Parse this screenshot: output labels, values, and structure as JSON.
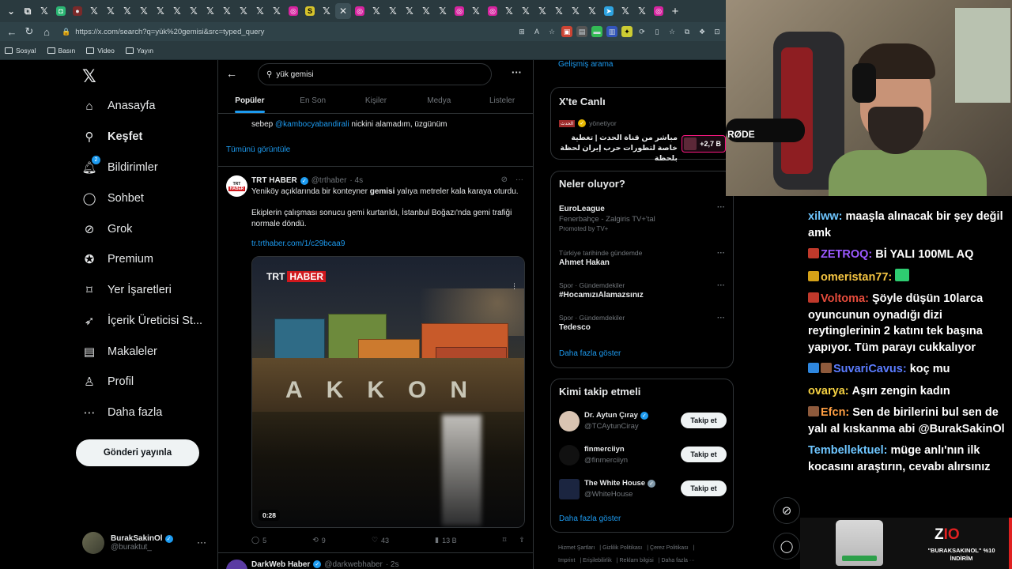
{
  "browser": {
    "tabs": [
      "",
      "",
      "",
      "",
      "",
      "",
      "",
      "",
      "",
      "",
      "",
      "",
      "",
      "",
      "",
      "",
      "",
      "",
      "",
      "",
      "",
      "",
      "",
      "",
      "",
      "",
      "",
      "",
      "",
      "",
      "",
      "",
      "",
      "",
      "",
      "",
      "",
      "",
      "",
      "",
      "",
      ""
    ],
    "url": "https://x.com/search?q=yük%20gemisi&src=typed_query",
    "bookmarks": [
      "Sosyal",
      "Basın",
      "Video",
      "Yayın"
    ]
  },
  "nav": {
    "items": [
      "Anasayfa",
      "Keşfet",
      "Bildirimler",
      "Sohbet",
      "Grok",
      "Premium",
      "Yer İşaretleri",
      "İçerik Üreticisi St...",
      "Makaleler",
      "Profil",
      "Daha fazla"
    ],
    "notif_badge": "2",
    "post_button": "Gönderi yayınla",
    "account_name": "BurakSakinOl",
    "account_handle": "@buraktut_"
  },
  "search": {
    "query": "yük gemisi",
    "tabs": [
      "Popüler",
      "En Son",
      "Kişiler",
      "Medya",
      "Listeler"
    ]
  },
  "prev_post": {
    "text_prefix": "sebep ",
    "mention": "@kambocyabandirali",
    "text_suffix": " nickini alamadım, üzgünüm",
    "show_all": "Tümünü görüntüle"
  },
  "tweet": {
    "avatar_top": "TRT",
    "avatar_bottom": "HABER",
    "name": "TRT HABER",
    "handle": "@trthaber",
    "time": "· 4s",
    "line1_pre": "Yeniköy açıklarında bir konteyner ",
    "line1_bold": "gemisi",
    "line1_post": " yalıya metreler kala karaya oturdu.",
    "line2": "Ekiplerin çalışması sonucu gemi kurtarıldı, İstanbul Boğazı'nda gemi trafiği normale döndü.",
    "link": "tr.trthaber.com/1/c29bcaa9",
    "media_logo_a": "TRT",
    "media_logo_b": "HABER",
    "media_ship_text": "AKKON",
    "duration": "0:28",
    "replies": "5",
    "reposts": "9",
    "likes": "43",
    "views": "13 B"
  },
  "next_tweet": {
    "name": "DarkWeb Haber",
    "handle": "@darkwebhaber",
    "time": "· 2s"
  },
  "right": {
    "advanced_search": "Gelişmiş arama",
    "live_title": "X'te Canlı",
    "live_source": "yönetiyor",
    "live_text": "مباشر من قناة الحدث | تغطية خاصة لتطورات حرب إيران لحظة بلحظة",
    "live_count": "+2,7 B",
    "trends_title": "Neler oluyor?",
    "trends": [
      {
        "ctx": "",
        "title": "EuroLeague",
        "sub": "Fenerbahçe - Zalgiris TV+'tal",
        "promo": "Promoted by TV+"
      },
      {
        "ctx": "Türkiye tarihinde gündemde",
        "title": "Ahmet Hakan",
        "sub": "",
        "promo": ""
      },
      {
        "ctx": "Spor · Gündemdekiler",
        "title": "#HocamızıAlamazsınız",
        "sub": "",
        "promo": ""
      },
      {
        "ctx": "Spor · Gündemdekiler",
        "title": "Tedesco",
        "sub": "",
        "promo": ""
      }
    ],
    "show_more": "Daha fazla göster",
    "who_title": "Kimi takip etmeli",
    "who": [
      {
        "name": "Dr. Aytun Çıray",
        "handle": "@TCAytunCiray",
        "btn": "Takip et"
      },
      {
        "name": "finmerciiyn",
        "handle": "@finmerciiyn",
        "btn": "Takip et"
      },
      {
        "name": "The White House",
        "handle": "@WhiteHouse",
        "btn": "Takip et"
      }
    ],
    "show_more2": "Daha fazla göster",
    "footer": [
      "Hizmet Şartları",
      "Gizlilik Politikası",
      "Çerez Politikası",
      "Imprint",
      "Erişilebilirlik",
      "Reklam bilgisi",
      "Daha fazla ···"
    ]
  },
  "stream": {
    "mic_label": "RØDE",
    "chat": [
      {
        "user": "xilww:",
        "color": "#6ec6ff",
        "text": "maaşla alınacak bir şey değil amk",
        "badge": ""
      },
      {
        "user": "ZETROQ:",
        "color": "#9b59ff",
        "text": "Bİ YALI 100ML AQ",
        "badge": "#c0392b"
      },
      {
        "user": "omeristan77:",
        "color": "#f5c542",
        "text": "",
        "badge": "#d4a017"
      },
      {
        "user": "Voltoma:",
        "color": "#e74c3c",
        "text": "Şöyle düşün 10larca oyuncunun oynadığı dizi reytinglerinin 2 katını tek başına yapıyor. Tüm parayı cukkalıyor",
        "badge": "#c0392b"
      },
      {
        "user": "SuvariCavus:",
        "color": "#5b7cff",
        "text": "koç mu",
        "badge": "#2e86de"
      },
      {
        "user": "ovarya:",
        "color": "#f5d142",
        "text": "Aşırı zengin kadın",
        "badge": ""
      },
      {
        "user": "Efcn:",
        "color": "#ff9f43",
        "text": "Sen de birilerini bul sen de yalı al kıskanma abi @BurakSakinOl",
        "badge": "#8e5a3c"
      },
      {
        "user": "Tembellektuel:",
        "color": "#6ec6ff",
        "text": "müge anlı'nın ilk kocasını araştırın, cevabı alırsınız",
        "badge": ""
      }
    ],
    "sponsor_brand_a": "Z",
    "sponsor_brand_b": "IO",
    "sponsor_code": "\"BURAKSAKINOL\" %10 İNDİRİM"
  },
  "colors": {
    "accent": "#1d9bf0",
    "background": "#000000",
    "follow_bg": "#eff3f4"
  }
}
